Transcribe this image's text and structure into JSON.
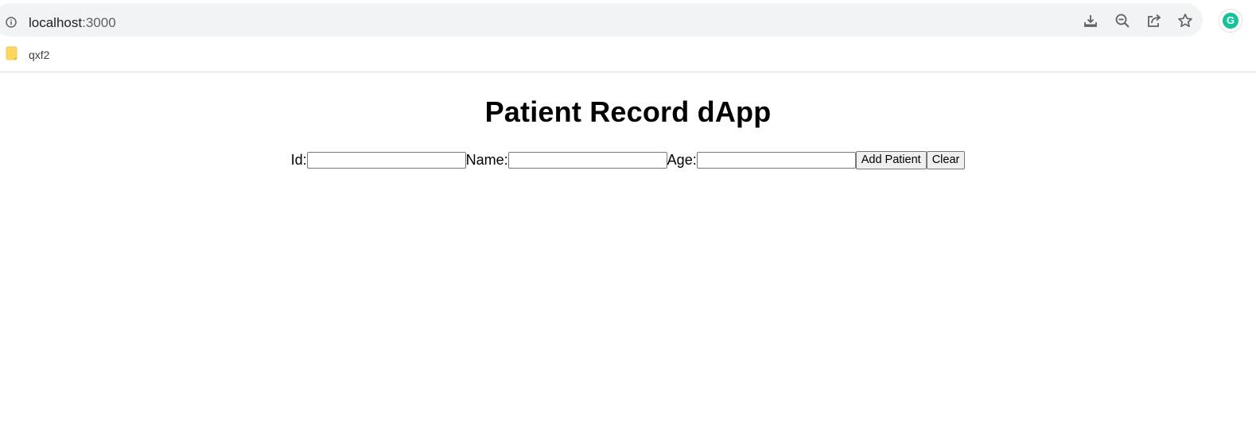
{
  "browser": {
    "url_host": "localhost",
    "url_port": ":3000",
    "toolbar_icons": [
      "install-app-icon",
      "zoom-out-icon",
      "share-icon",
      "bookmark-star-icon"
    ],
    "profile_letter": "G",
    "profile_color": "#15c39a"
  },
  "bookmarks": {
    "items": [
      {
        "label": "qxf2",
        "icon": "folder-icon"
      }
    ]
  },
  "page": {
    "title": "Patient Record dApp",
    "form": {
      "id_label": "Id:",
      "id_value": "",
      "name_label": "Name:",
      "name_value": "",
      "age_label": "Age:",
      "age_value": "",
      "add_button": "Add Patient",
      "clear_button": "Clear"
    }
  }
}
